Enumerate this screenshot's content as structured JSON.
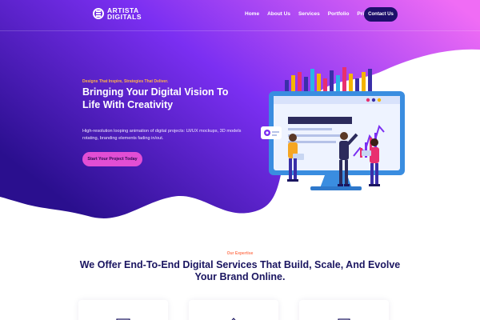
{
  "brand": {
    "line1": "ARTISTA",
    "line2": "DIGITALS"
  },
  "nav": {
    "items": [
      "Home",
      "About Us",
      "Services",
      "Portfolio",
      "Pricing"
    ],
    "contact_label": "Contact Us"
  },
  "hero": {
    "eyebrow": "Designs That Inspire, Strategies That Deliver.",
    "title": "Bringing Your Digital Vision To Life With Creativity",
    "description": "High-resolution looping animation of digital projects: UI/UX mockups, 3D models rotating, branding elements fading in/out.",
    "cta_label": "Start Your Project Today"
  },
  "expertise": {
    "label": "Our Expertise",
    "title": "We Offer End-To-End Digital Services That Build, Scale, And Evolve Your Brand Online."
  },
  "colors": {
    "gradient_start": "#2a0f8e",
    "gradient_mid": "#7b2ff2",
    "gradient_end": "#f06cf5",
    "navy": "#1d0f6b",
    "accent_pink": "#e24ed4",
    "eyebrow_orange": "#ffb347"
  }
}
